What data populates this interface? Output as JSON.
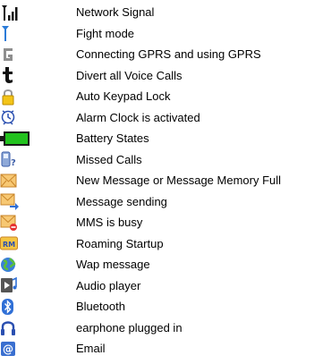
{
  "items": [
    {
      "icon": "signal-bars-icon",
      "label": "Network Signal"
    },
    {
      "icon": "antenna-icon",
      "label": "Fight mode"
    },
    {
      "icon": "gprs-g-icon",
      "label": "Connecting GPRS and using GPRS"
    },
    {
      "icon": "divert-calls-icon",
      "label": "Divert all Voice Calls"
    },
    {
      "icon": "padlock-icon",
      "label": "Auto Keypad Lock"
    },
    {
      "icon": "alarm-clock-icon",
      "label": "Alarm Clock is activated"
    },
    {
      "icon": "battery-icon",
      "label": "Battery States"
    },
    {
      "icon": "missed-call-icon",
      "label": "Missed Calls"
    },
    {
      "icon": "envelope-icon",
      "label": "New Message or Message Memory Full"
    },
    {
      "icon": "envelope-send-icon",
      "label": "Message sending"
    },
    {
      "icon": "envelope-busy-icon",
      "label": "MMS is busy"
    },
    {
      "icon": "roaming-rm-icon",
      "label": "Roaming Startup"
    },
    {
      "icon": "globe-icon",
      "label": "Wap message"
    },
    {
      "icon": "audio-player-icon",
      "label": "Audio player"
    },
    {
      "icon": "bluetooth-icon",
      "label": "Bluetooth"
    },
    {
      "icon": "headphones-icon",
      "label": "earphone plugged in"
    },
    {
      "icon": "email-at-icon",
      "label": "Email"
    }
  ],
  "colors": {
    "envelope_fill": "#f7c873",
    "envelope_stroke": "#c9852a",
    "battery_green": "#22c21e",
    "bluetooth_blue": "#2f6fd6",
    "lock_yellow": "#f3c417"
  }
}
